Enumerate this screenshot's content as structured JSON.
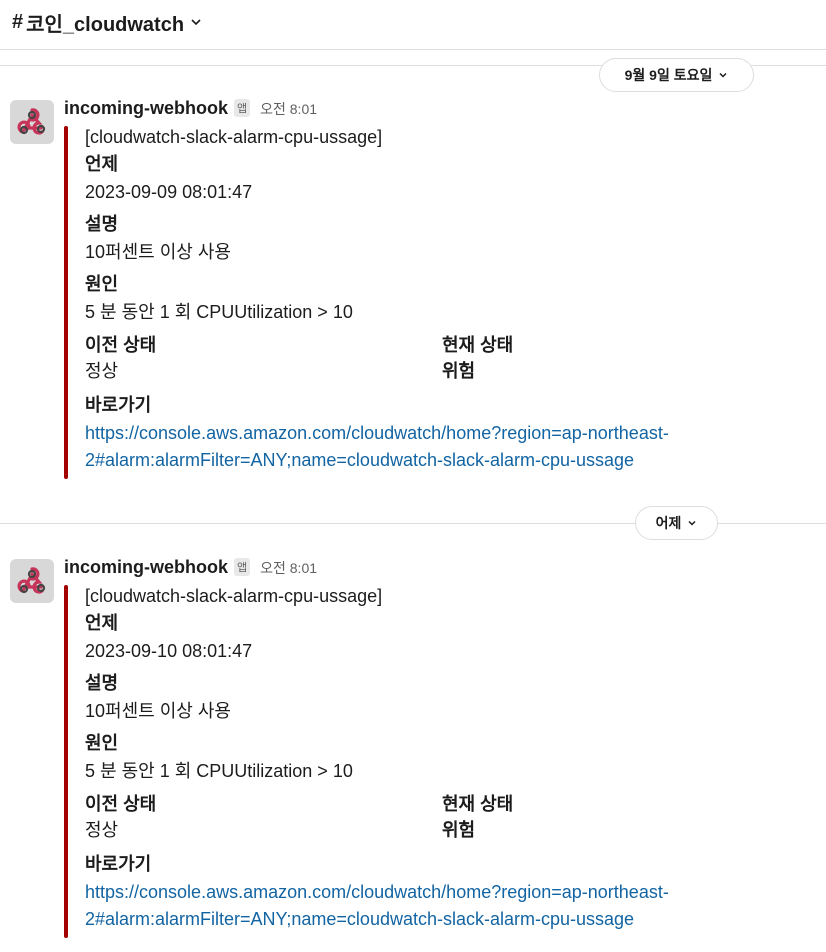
{
  "channel": {
    "hash": "#",
    "name": "코인_cloudwatch"
  },
  "dividers": [
    {
      "label": "9월 9일 토요일"
    },
    {
      "label": "어제"
    }
  ],
  "messages": [
    {
      "sender": "incoming-webhook",
      "badge": "앱",
      "time": "오전 8:01",
      "title": "[cloudwatch-slack-alarm-cpu-ussage]",
      "when_label": "언제",
      "when_value": "2023-09-09 08:01:47",
      "desc_label": "설명",
      "desc_value": "10퍼센트 이상 사용",
      "cause_label": "원인",
      "cause_value": "5 분 동안 1 회 CPUUtilization > 10",
      "prev_label": "이전 상태",
      "prev_value": "정상",
      "curr_label": "현재 상태",
      "curr_value": "위험",
      "link_label": "바로가기",
      "link_line1": "https://console.aws.amazon.com/cloudwatch/home?region=ap-northeast-",
      "link_line2": "2#alarm:alarmFilter=ANY;name=cloudwatch-slack-alarm-cpu-ussage"
    },
    {
      "sender": "incoming-webhook",
      "badge": "앱",
      "time": "오전 8:01",
      "title": "[cloudwatch-slack-alarm-cpu-ussage]",
      "when_label": "언제",
      "when_value": "2023-09-10 08:01:47",
      "desc_label": "설명",
      "desc_value": "10퍼센트 이상 사용",
      "cause_label": "원인",
      "cause_value": "5 분 동안 1 회 CPUUtilization > 10",
      "prev_label": "이전 상태",
      "prev_value": "정상",
      "curr_label": "현재 상태",
      "curr_value": "위험",
      "link_label": "바로가기",
      "link_line1": "https://console.aws.amazon.com/cloudwatch/home?region=ap-northeast-",
      "link_line2": "2#alarm:alarmFilter=ANY;name=cloudwatch-slack-alarm-cpu-ussage"
    }
  ],
  "colors": {
    "attachment_bar": "#a30200",
    "link": "#1264a3"
  },
  "icons": {
    "avatar": "webhook-icon",
    "channel_menu": "chevron-down-icon"
  }
}
